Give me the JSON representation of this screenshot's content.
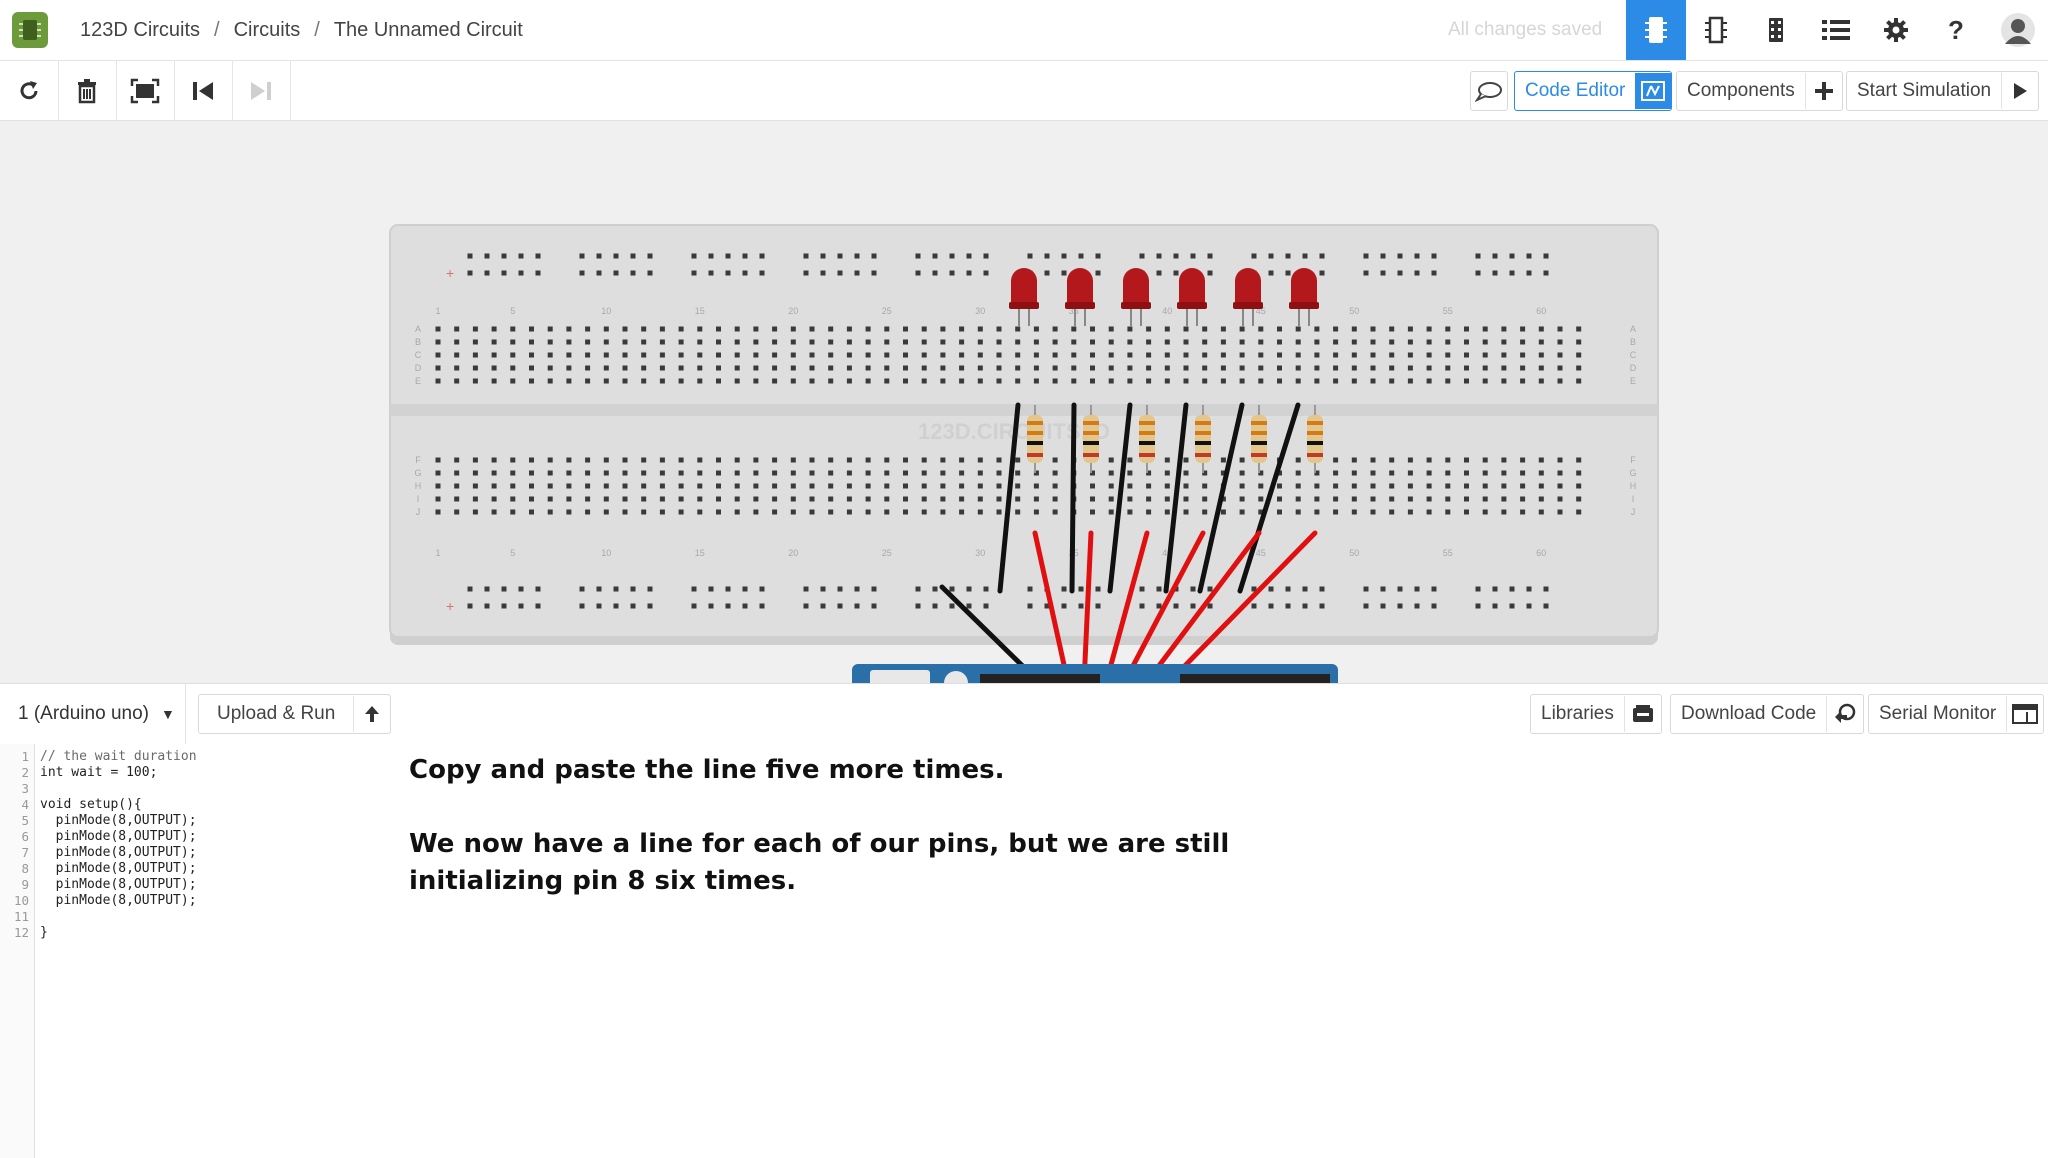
{
  "app": {
    "name": "123D Circuits"
  },
  "breadcrumb": [
    "123D Circuits",
    "Circuits",
    "The Unnamed Circuit"
  ],
  "save_status": "All changes saved",
  "top_icons": [
    "breadboard-view-icon",
    "schematic-view-icon",
    "pcb-view-icon",
    "list-icon",
    "gear-icon",
    "help-icon",
    "user-avatar-icon"
  ],
  "help_glyph": "?",
  "toolbar": {
    "tools": [
      "rotate-icon",
      "trash-icon",
      "fit-view-icon",
      "step-back-icon",
      "step-forward-icon"
    ],
    "comment_icon": "speech-bubble-icon",
    "code_editor_label": "Code Editor",
    "components_label": "Components",
    "start_simulation_label": "Start Simulation"
  },
  "breadboard": {
    "watermark": "123D.CIRCUITS.IO",
    "column_numbers": [
      "1",
      "5",
      "10",
      "15",
      "20",
      "25",
      "30",
      "35",
      "40",
      "45",
      "50",
      "55",
      "60"
    ],
    "row_letters_top": [
      "A",
      "B",
      "C",
      "D",
      "E"
    ],
    "row_letters_bottom": [
      "F",
      "G",
      "H",
      "I",
      "J"
    ],
    "led_color": "#b3181c",
    "wire_colors": {
      "ground": "#111111",
      "signal": "#e01010"
    }
  },
  "code_panel": {
    "board_select": "1 (Arduino uno)",
    "upload_run_label": "Upload & Run",
    "libraries_label": "Libraries",
    "download_code_label": "Download Code",
    "serial_monitor_label": "Serial Monitor"
  },
  "code_lines": [
    "// the wait duration",
    "int wait = 100;",
    "",
    "void setup(){",
    "  pinMode(8,OUTPUT);",
    "  pinMode(8,OUTPUT);",
    "  pinMode(8,OUTPUT);",
    "  pinMode(8,OUTPUT);",
    "  pinMode(8,OUTPUT);",
    "  pinMode(8,OUTPUT);",
    "",
    "}"
  ],
  "line_numbers": [
    "1",
    "2",
    "3",
    "4",
    "5",
    "6",
    "7",
    "8",
    "9",
    "10",
    "11",
    "12"
  ],
  "annotation": {
    "line1": "Copy and paste the line five more times.",
    "line2": "We now have a line for each of our pins, but we are still",
    "line3": "initializing pin 8 six times."
  },
  "colors": {
    "accent": "#2c8be6",
    "logo": "#6d9a3a"
  }
}
